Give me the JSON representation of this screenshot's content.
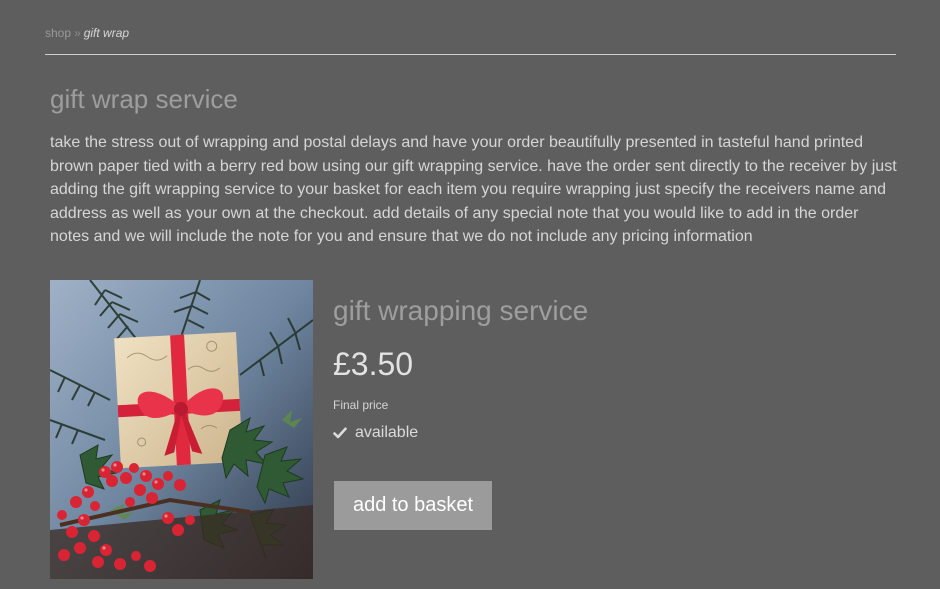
{
  "breadcrumb": {
    "parent": "shop",
    "separator": "»",
    "current": "gift wrap"
  },
  "page": {
    "title": "gift wrap service",
    "description": "take the stress out of wrapping and postal delays and have your order beautifully presented in tasteful hand printed brown paper tied with a berry red bow using our gift wrapping service. have the order sent directly to the receiver by just adding the gift wrapping service to your basket for each item you require wrapping just specify the receivers name and address as well as your own at the checkout. add details of any special note that you would like to add in the order notes and we will include the note for you and ensure that we do not include any pricing information"
  },
  "product": {
    "name": "gift wrapping service",
    "price": "£3.50",
    "price_note": "Final price",
    "availability": "available",
    "availability_icon": "check-icon",
    "add_button_label": "add to basket",
    "image": "gift-parcel-photo"
  },
  "colors": {
    "background": "#5e5e5e",
    "button": "#9b9b9b",
    "muted_heading": "#9e9e9e",
    "bow_red": "#e0283f"
  }
}
